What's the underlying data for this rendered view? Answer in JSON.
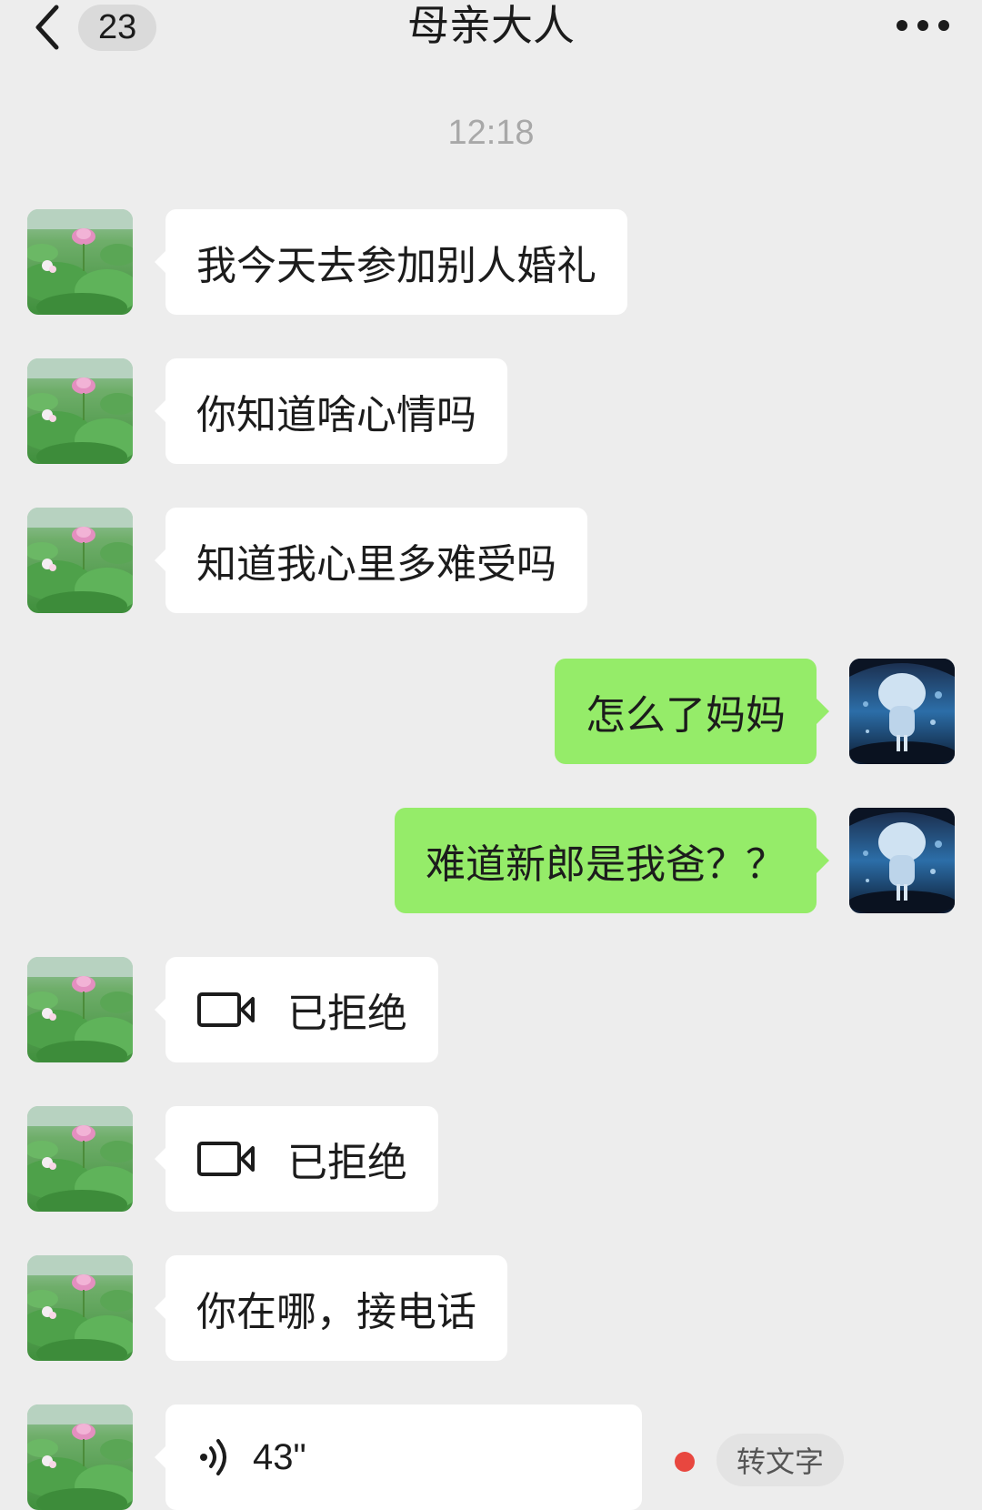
{
  "header": {
    "unread_count": "23",
    "title": "母亲大人"
  },
  "timestamp": "12:18",
  "messages": [
    {
      "side": "left",
      "type": "text",
      "text": "我今天去参加别人婚礼"
    },
    {
      "side": "left",
      "type": "text",
      "text": "你知道啥心情吗"
    },
    {
      "side": "left",
      "type": "text",
      "text": "知道我心里多难受吗"
    },
    {
      "side": "right",
      "type": "text",
      "text": "怎么了妈妈"
    },
    {
      "side": "right",
      "type": "text",
      "text": "难道新郎是我爸？？"
    },
    {
      "side": "left",
      "type": "video_call",
      "text": "已拒绝",
      "icon": "video-camera-icon"
    },
    {
      "side": "left",
      "type": "video_call",
      "text": "已拒绝",
      "icon": "video-camera-icon"
    },
    {
      "side": "left",
      "type": "text",
      "text": "你在哪，接电话"
    },
    {
      "side": "left",
      "type": "voice",
      "text": "43\"",
      "icon": "voice-wave-icon",
      "action_label": "转文字",
      "unread": true
    }
  ],
  "colors": {
    "background": "#ededed",
    "received_bubble": "#ffffff",
    "sent_bubble": "#95ec69",
    "unread_dot": "#e8473f"
  }
}
